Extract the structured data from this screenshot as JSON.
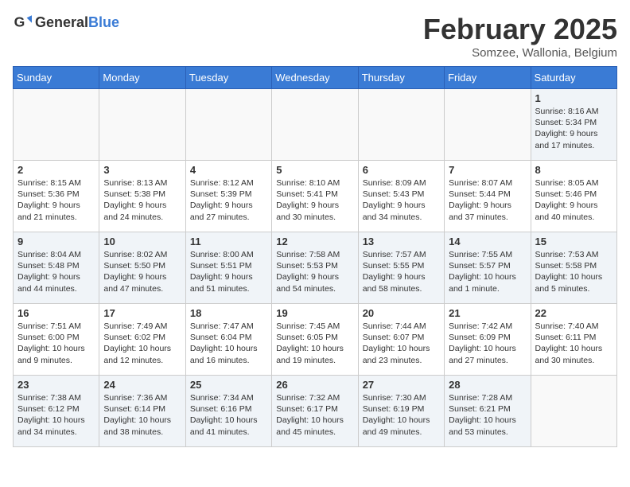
{
  "header": {
    "logo": {
      "general": "General",
      "blue": "Blue"
    },
    "title": "February 2025",
    "subtitle": "Somzee, Wallonia, Belgium"
  },
  "days_of_week": [
    "Sunday",
    "Monday",
    "Tuesday",
    "Wednesday",
    "Thursday",
    "Friday",
    "Saturday"
  ],
  "weeks": [
    [
      {
        "day": "",
        "info": ""
      },
      {
        "day": "",
        "info": ""
      },
      {
        "day": "",
        "info": ""
      },
      {
        "day": "",
        "info": ""
      },
      {
        "day": "",
        "info": ""
      },
      {
        "day": "",
        "info": ""
      },
      {
        "day": "1",
        "info": "Sunrise: 8:16 AM\nSunset: 5:34 PM\nDaylight: 9 hours and 17 minutes."
      }
    ],
    [
      {
        "day": "2",
        "info": "Sunrise: 8:15 AM\nSunset: 5:36 PM\nDaylight: 9 hours and 21 minutes."
      },
      {
        "day": "3",
        "info": "Sunrise: 8:13 AM\nSunset: 5:38 PM\nDaylight: 9 hours and 24 minutes."
      },
      {
        "day": "4",
        "info": "Sunrise: 8:12 AM\nSunset: 5:39 PM\nDaylight: 9 hours and 27 minutes."
      },
      {
        "day": "5",
        "info": "Sunrise: 8:10 AM\nSunset: 5:41 PM\nDaylight: 9 hours and 30 minutes."
      },
      {
        "day": "6",
        "info": "Sunrise: 8:09 AM\nSunset: 5:43 PM\nDaylight: 9 hours and 34 minutes."
      },
      {
        "day": "7",
        "info": "Sunrise: 8:07 AM\nSunset: 5:44 PM\nDaylight: 9 hours and 37 minutes."
      },
      {
        "day": "8",
        "info": "Sunrise: 8:05 AM\nSunset: 5:46 PM\nDaylight: 9 hours and 40 minutes."
      }
    ],
    [
      {
        "day": "9",
        "info": "Sunrise: 8:04 AM\nSunset: 5:48 PM\nDaylight: 9 hours and 44 minutes."
      },
      {
        "day": "10",
        "info": "Sunrise: 8:02 AM\nSunset: 5:50 PM\nDaylight: 9 hours and 47 minutes."
      },
      {
        "day": "11",
        "info": "Sunrise: 8:00 AM\nSunset: 5:51 PM\nDaylight: 9 hours and 51 minutes."
      },
      {
        "day": "12",
        "info": "Sunrise: 7:58 AM\nSunset: 5:53 PM\nDaylight: 9 hours and 54 minutes."
      },
      {
        "day": "13",
        "info": "Sunrise: 7:57 AM\nSunset: 5:55 PM\nDaylight: 9 hours and 58 minutes."
      },
      {
        "day": "14",
        "info": "Sunrise: 7:55 AM\nSunset: 5:57 PM\nDaylight: 10 hours and 1 minute."
      },
      {
        "day": "15",
        "info": "Sunrise: 7:53 AM\nSunset: 5:58 PM\nDaylight: 10 hours and 5 minutes."
      }
    ],
    [
      {
        "day": "16",
        "info": "Sunrise: 7:51 AM\nSunset: 6:00 PM\nDaylight: 10 hours and 9 minutes."
      },
      {
        "day": "17",
        "info": "Sunrise: 7:49 AM\nSunset: 6:02 PM\nDaylight: 10 hours and 12 minutes."
      },
      {
        "day": "18",
        "info": "Sunrise: 7:47 AM\nSunset: 6:04 PM\nDaylight: 10 hours and 16 minutes."
      },
      {
        "day": "19",
        "info": "Sunrise: 7:45 AM\nSunset: 6:05 PM\nDaylight: 10 hours and 19 minutes."
      },
      {
        "day": "20",
        "info": "Sunrise: 7:44 AM\nSunset: 6:07 PM\nDaylight: 10 hours and 23 minutes."
      },
      {
        "day": "21",
        "info": "Sunrise: 7:42 AM\nSunset: 6:09 PM\nDaylight: 10 hours and 27 minutes."
      },
      {
        "day": "22",
        "info": "Sunrise: 7:40 AM\nSunset: 6:11 PM\nDaylight: 10 hours and 30 minutes."
      }
    ],
    [
      {
        "day": "23",
        "info": "Sunrise: 7:38 AM\nSunset: 6:12 PM\nDaylight: 10 hours and 34 minutes."
      },
      {
        "day": "24",
        "info": "Sunrise: 7:36 AM\nSunset: 6:14 PM\nDaylight: 10 hours and 38 minutes."
      },
      {
        "day": "25",
        "info": "Sunrise: 7:34 AM\nSunset: 6:16 PM\nDaylight: 10 hours and 41 minutes."
      },
      {
        "day": "26",
        "info": "Sunrise: 7:32 AM\nSunset: 6:17 PM\nDaylight: 10 hours and 45 minutes."
      },
      {
        "day": "27",
        "info": "Sunrise: 7:30 AM\nSunset: 6:19 PM\nDaylight: 10 hours and 49 minutes."
      },
      {
        "day": "28",
        "info": "Sunrise: 7:28 AM\nSunset: 6:21 PM\nDaylight: 10 hours and 53 minutes."
      },
      {
        "day": "",
        "info": ""
      }
    ]
  ]
}
